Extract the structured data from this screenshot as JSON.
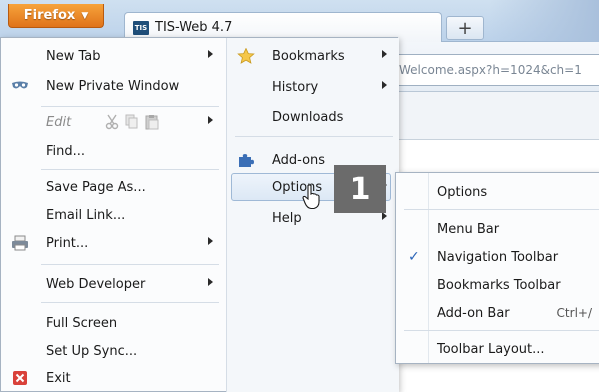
{
  "browser": {
    "firefox_button": "Firefox",
    "tab_title": "TIS-Web 4.7",
    "tab_favicon_text": "TIS",
    "new_tab_label": "+",
    "url_text": "Welcome.aspx?h=1024&ch=1"
  },
  "main_menu": {
    "left": {
      "new_tab": "New Tab",
      "new_private_window": "New Private Window",
      "edit": "Edit",
      "find": "Find...",
      "save_page_as": "Save Page As...",
      "email_link": "Email Link...",
      "print": "Print...",
      "web_developer": "Web Developer",
      "full_screen": "Full Screen",
      "set_up_sync": "Set Up Sync...",
      "exit": "Exit"
    },
    "right": {
      "bookmarks": "Bookmarks",
      "history": "History",
      "downloads": "Downloads",
      "add_ons": "Add-ons",
      "options": "Options",
      "help": "Help"
    }
  },
  "step_badge": "1",
  "options_submenu": {
    "options": "Options",
    "menu_bar": "Menu Bar",
    "navigation_toolbar": "Navigation Toolbar",
    "navigation_toolbar_checked": true,
    "bookmarks_toolbar": "Bookmarks Toolbar",
    "add_on_bar": "Add-on Bar",
    "add_on_bar_shortcut": "Ctrl+/",
    "toolbar_layout": "Toolbar Layout..."
  },
  "colors": {
    "firefox_orange": "#e0731a",
    "selection_blue": "#dce8f5",
    "badge_gray": "#6b6b6b",
    "check_blue": "#2a64b8"
  }
}
